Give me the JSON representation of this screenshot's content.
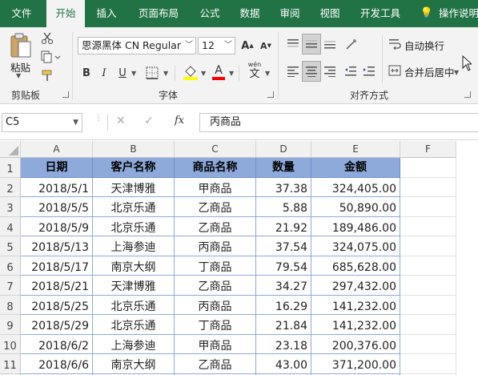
{
  "ribbon_tabs": [
    "文件",
    "开始",
    "插入",
    "页面布局",
    "公式",
    "数据",
    "审阅",
    "视图",
    "开发工具",
    "操作说明"
  ],
  "ribbon": {
    "paste_label": "粘贴",
    "clipboard_group": "剪贴板",
    "font_group": "字体",
    "align_group": "对齐方式",
    "font_name": "思源黑体 CN Regular",
    "font_size": "12",
    "wrap_text": "自动换行",
    "merge_center": "合并后居中",
    "bold": "B",
    "italic": "I",
    "underline": "U",
    "wen_label": "wén",
    "wen_char": "文",
    "font_color_letter": "A",
    "lightbulb": "💡",
    "colors": {
      "fill_highlight": "#ffff00",
      "font_red": "#ff0000",
      "accent": "#217346",
      "header_fill": "#8eaadb"
    }
  },
  "formula_bar": {
    "name_box": "C5",
    "fx": "fx",
    "formula": "丙商品"
  },
  "sheet": {
    "columns": [
      "A",
      "B",
      "C",
      "D",
      "E",
      "F"
    ],
    "row_numbers": [
      "1",
      "2",
      "3",
      "4",
      "5",
      "6",
      "7",
      "8",
      "9",
      "10",
      "11"
    ],
    "headers": [
      "日期",
      "客户名称",
      "商品名称",
      "数量",
      "金额"
    ],
    "rows": [
      [
        "2018/5/1",
        "天津博雅",
        "甲商品",
        "37.38",
        "324,405.00"
      ],
      [
        "2018/5/5",
        "北京乐通",
        "乙商品",
        "5.88",
        "50,890.00"
      ],
      [
        "2018/5/9",
        "北京乐通",
        "乙商品",
        "21.92",
        "189,486.00"
      ],
      [
        "2018/5/13",
        "上海参迪",
        "丙商品",
        "37.54",
        "324,075.00"
      ],
      [
        "2018/5/17",
        "南京大纲",
        "丁商品",
        "79.54",
        "685,628.00"
      ],
      [
        "2018/5/21",
        "天津博雅",
        "乙商品",
        "34.27",
        "297,432.00"
      ],
      [
        "2018/5/25",
        "北京乐通",
        "丙商品",
        "16.29",
        "141,232.00"
      ],
      [
        "2018/5/29",
        "北京乐通",
        "丁商品",
        "21.84",
        "141,232.00"
      ],
      [
        "2018/6/2",
        "上海参迪",
        "甲商品",
        "23.18",
        "200,376.00"
      ],
      [
        "2018/6/6",
        "南京大纲",
        "乙商品",
        "43.00",
        "371,200.00"
      ]
    ]
  }
}
